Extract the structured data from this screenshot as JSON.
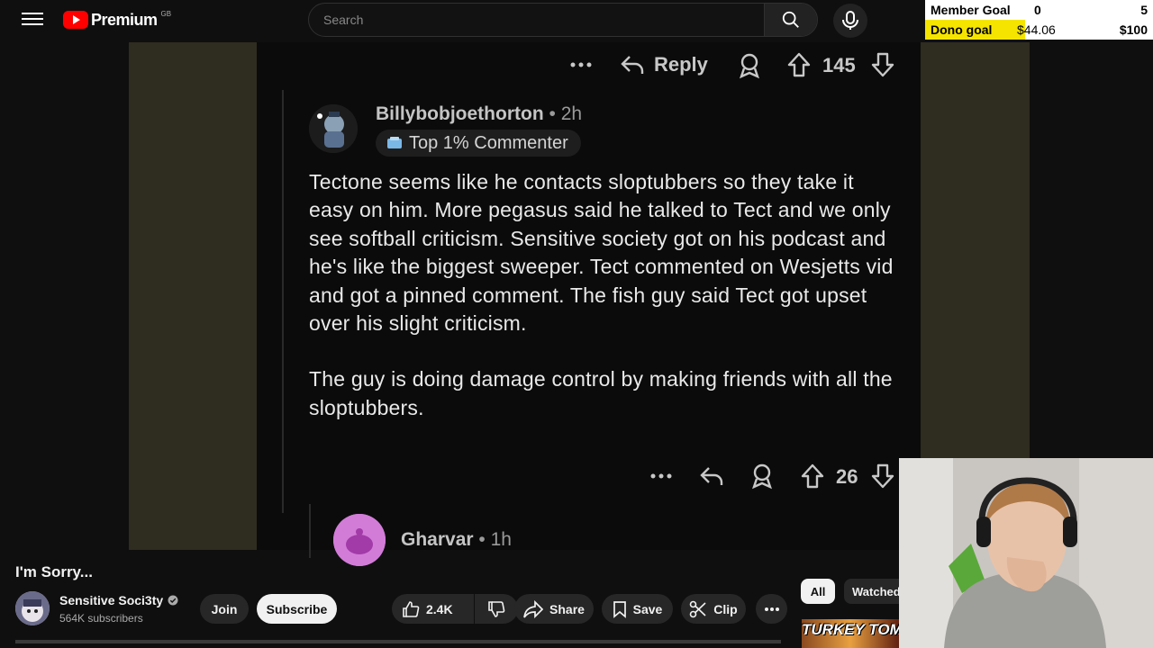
{
  "header": {
    "logo_text": "Premium",
    "region": "GB",
    "search_placeholder": "Search"
  },
  "goal_overlay": {
    "member": {
      "label": "Member Goal",
      "current": "0",
      "target": "5",
      "progress": 0.0
    },
    "dono": {
      "label": "Dono goal",
      "current": "$44.06",
      "target": "$100",
      "progress": 0.44
    }
  },
  "reddit": {
    "top_actions": {
      "reply_label": "Reply",
      "score": "145"
    },
    "comment": {
      "author": "Billybobjoethorton",
      "time": "2h",
      "badge": "Top 1% Commenter",
      "paragraph1": "Tectone seems like he contacts sloptubbers so they take it easy on him. More pegasus said he talked to Tect and we only see softball criticism. Sensitive society got on his podcast and he's like the biggest sweeper. Tect commented on Wesjetts vid and got a pinned comment. The fish guy said Tect got upset over his slight criticism.",
      "paragraph2": "The guy is doing damage control by making friends with all the sloptubbers.",
      "score": "26"
    },
    "next_comment": {
      "author": "Gharvar",
      "time": "1h"
    }
  },
  "video": {
    "title": "I'm Sorry...",
    "channel_name": "Sensitive Soci3ty",
    "subscribers": "564K subscribers",
    "join_label": "Join",
    "subscribe_label": "Subscribe",
    "likes": "2.4K",
    "share_label": "Share",
    "save_label": "Save",
    "clip_label": "Clip",
    "progress": 0.0
  },
  "chips": {
    "all": "All",
    "watched": "Watched"
  },
  "recommendation": {
    "thumb_text": "TURKEY TOM VS"
  },
  "colors": {
    "youtube_red": "#ff0000",
    "goal_yellow": "#f5e400",
    "side_panel": "#2f2c20"
  }
}
